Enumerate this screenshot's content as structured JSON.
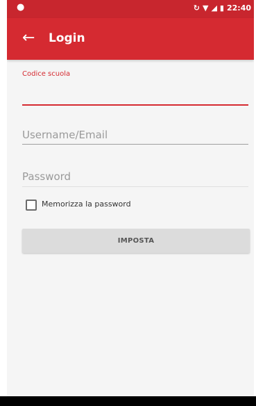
{
  "status_bar": {
    "time": "22:40",
    "icons": [
      "notification-icon",
      "sync-icon",
      "wifi-icon",
      "signal-icon",
      "battery-icon"
    ]
  },
  "app_bar": {
    "title": "Login",
    "back_icon": "arrow-left-icon"
  },
  "form": {
    "school_code_label": "Codice scuola",
    "username_placeholder": "Username/Email",
    "password_placeholder": "Password",
    "remember_label": "Memorizza la password",
    "remember_checked": false,
    "submit_label": "IMPOSTA"
  },
  "colors": {
    "primary": "#d52a31",
    "status_bar": "#c8262e",
    "button": "#dcdcdc"
  }
}
